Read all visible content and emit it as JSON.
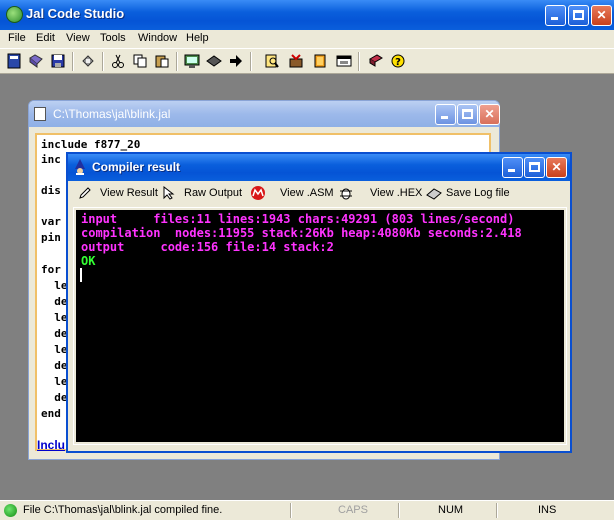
{
  "app": {
    "title": "Jal Code Studio"
  },
  "menu": [
    "File",
    "Edit",
    "View",
    "Tools",
    "Window",
    "Help"
  ],
  "toolbar": {
    "icons": [
      "new-file-icon",
      "open-file-icon",
      "save-icon",
      "print-icon",
      "cut-icon",
      "copy-icon",
      "paste-icon",
      "compile-icon",
      "chip-icon",
      "run-arrow-icon",
      "find-icon",
      "tools-icon",
      "bookmark-icon",
      "window-icon",
      "book-icon",
      "help-icon"
    ]
  },
  "editor": {
    "title": "C:\\Thomas\\jal\\blink.jal",
    "lines": [
      "include f877_20",
      "inc",
      "",
      "dis",
      "",
      "var",
      "pin",
      "",
      "for",
      "  le",
      "  de",
      "  le",
      "  de",
      "  le",
      "  de",
      "  le",
      "  de",
      "end"
    ],
    "link": "Inclu"
  },
  "compiler": {
    "title": "Compiler result",
    "tabs": [
      "View Result",
      "Raw Output",
      "View .ASM",
      "View .HEX",
      "Save Log file"
    ],
    "output": [
      {
        "text": "input     files:11 lines:1943 chars:49291 (803 lines/second)",
        "color": "#ff33ff"
      },
      {
        "text": "compilation  nodes:11955 stack:26Kb heap:4080Kb seconds:2.418",
        "color": "#ff33ff"
      },
      {
        "text": "output     code:156 file:14 stack:2",
        "color": "#ff33ff"
      },
      {
        "text": "OK",
        "color": "#33ff33"
      }
    ]
  },
  "status": {
    "message": "File C:\\Thomas\\jal\\blink.jal compiled fine.",
    "caps": "CAPS",
    "num": "NUM",
    "ins": "INS"
  },
  "colors": {
    "titlebar": "#0a5fdc",
    "chrome": "#ece9d8",
    "console_bg": "#000000",
    "output_magenta": "#ff33ff",
    "output_green": "#33ff33"
  }
}
